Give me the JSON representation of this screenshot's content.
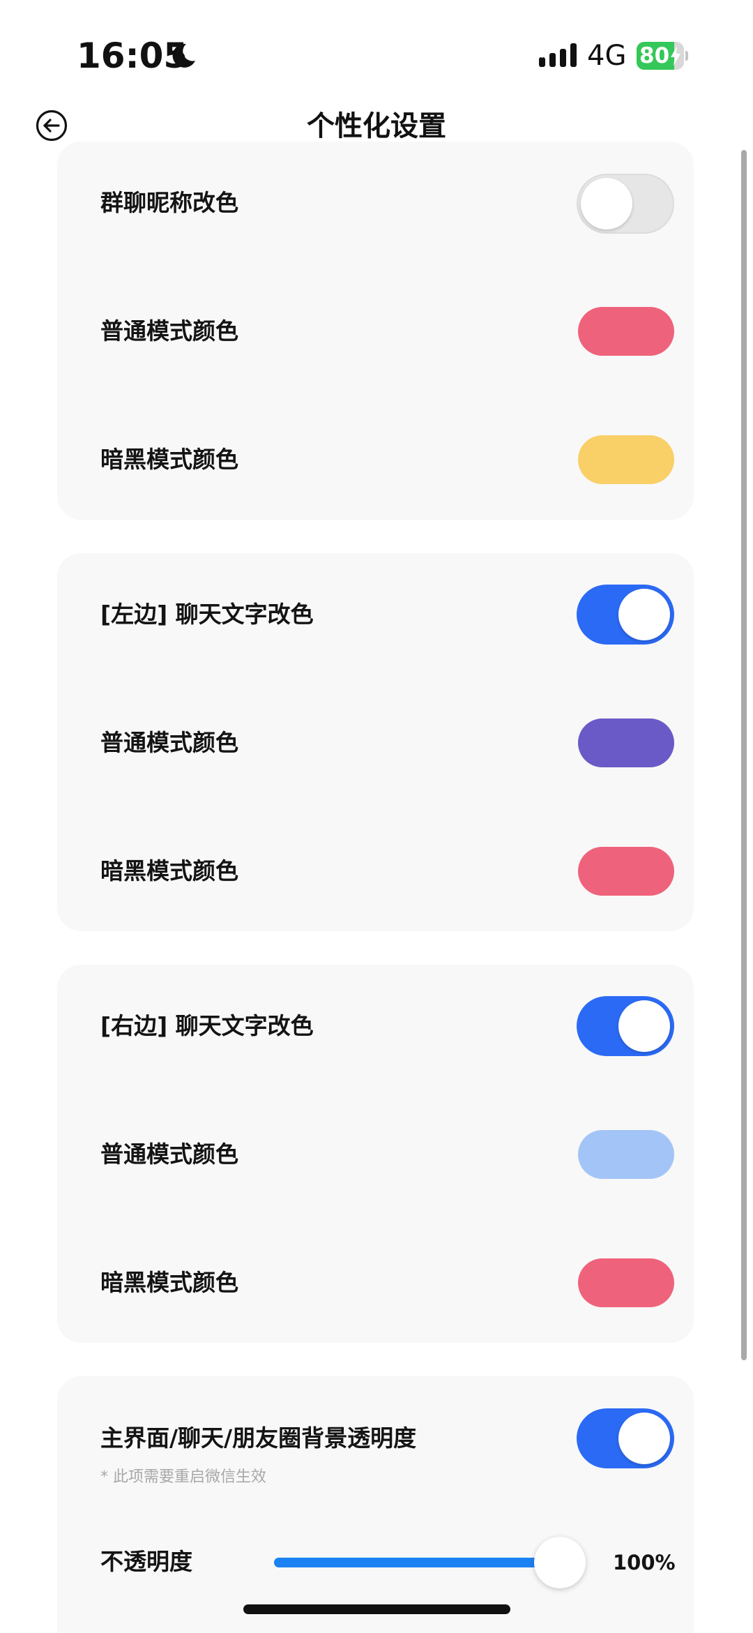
{
  "status_bar": {
    "time": "16:05",
    "network": "4G",
    "battery_percent": 80,
    "battery_label": "80",
    "battery_color": "#34c759"
  },
  "header": {
    "title": "个性化设置",
    "back_icon": "back-arrow-circle-icon"
  },
  "colors": {
    "toggle_on": "#2b6af5",
    "slider_fill": "#1a82f2",
    "card_background": "#f8f8f8"
  },
  "sections": [
    {
      "rows": [
        {
          "type": "toggle",
          "label": "群聊昵称改色",
          "on": false
        },
        {
          "type": "color",
          "label": "普通模式颜色",
          "color": "#ef627b"
        },
        {
          "type": "color",
          "label": "暗黑模式颜色",
          "color": "#f9cf67"
        }
      ]
    },
    {
      "rows": [
        {
          "type": "toggle",
          "label": "[左边] 聊天文字改色",
          "on": true
        },
        {
          "type": "color",
          "label": "普通模式颜色",
          "color": "#6a5ac7"
        },
        {
          "type": "color",
          "label": "暗黑模式颜色",
          "color": "#ef627b"
        }
      ]
    },
    {
      "rows": [
        {
          "type": "toggle",
          "label": "[右边] 聊天文字改色",
          "on": true
        },
        {
          "type": "color",
          "label": "普通模式颜色",
          "color": "#a3c4f7"
        },
        {
          "type": "color",
          "label": "暗黑模式颜色",
          "color": "#ef627b"
        }
      ]
    },
    {
      "rows": [
        {
          "type": "toggle",
          "label": "主界面/聊天/朋友圈背景透明度",
          "on": true,
          "note": "* 此项需要重启微信生效"
        },
        {
          "type": "slider",
          "label": "不透明度",
          "value": 100,
          "value_label": "100%"
        }
      ]
    }
  ]
}
